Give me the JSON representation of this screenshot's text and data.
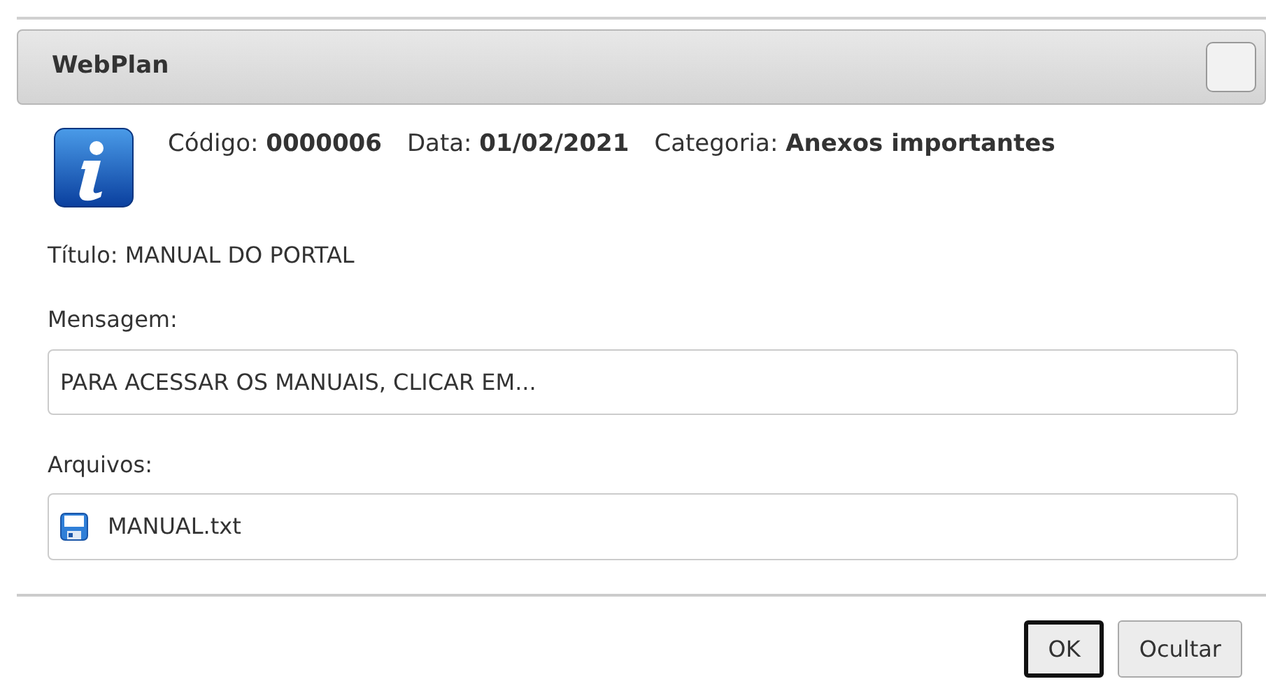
{
  "dialog": {
    "title": "WebPlan",
    "meta": [
      {
        "label": "Código:",
        "value": "0000006"
      },
      {
        "label": "Data:",
        "value": "01/02/2021"
      },
      {
        "label": "Categoria:",
        "value": "Anexos importantes"
      }
    ],
    "titulo": "Título: MANUAL DO PORTAL",
    "message_label": "Mensagem:",
    "message": "PARA ACESSAR OS MANUAIS, CLICAR EM...",
    "files_label": "Arquivos:",
    "files": [
      {
        "name": "MANUAL.txt"
      }
    ],
    "buttons": [
      {
        "label": "OK",
        "focused": true
      },
      {
        "label": "Ocultar",
        "focused": false
      }
    ]
  }
}
